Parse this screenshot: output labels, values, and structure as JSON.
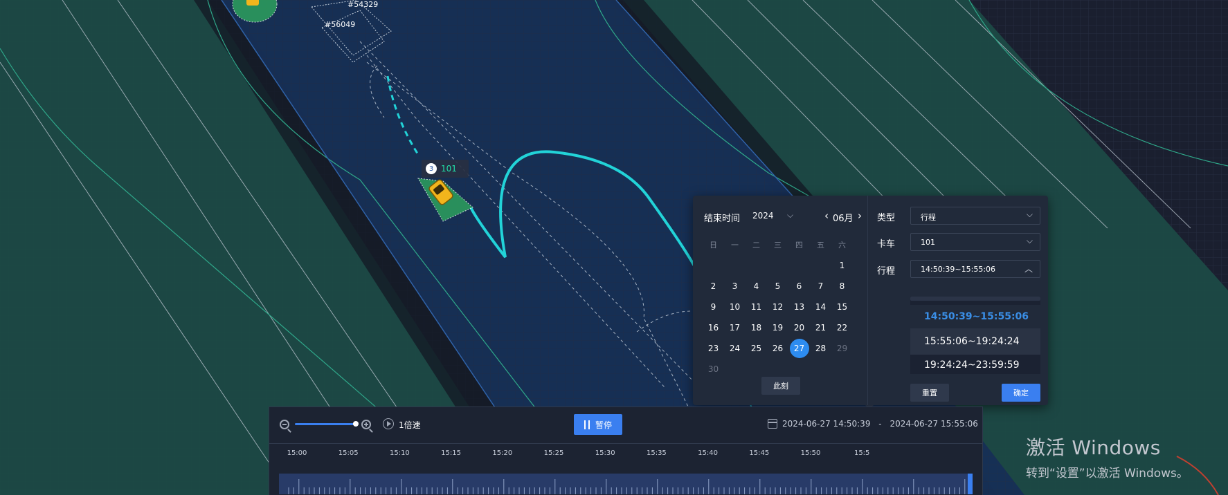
{
  "map": {
    "marker_labels": [
      {
        "text": "#54329"
      },
      {
        "text": "#56049"
      }
    ],
    "vehicle_tag": {
      "count": "3",
      "name": "101"
    }
  },
  "picker": {
    "calendar": {
      "title": "结束时间",
      "year": "2024",
      "month": "06月",
      "weekdays": [
        "日",
        "一",
        "二",
        "三",
        "四",
        "五",
        "六"
      ],
      "weeks": [
        [
          "",
          "",
          "",
          "",
          "",
          "",
          "1"
        ],
        [
          "2",
          "3",
          "4",
          "5",
          "6",
          "7",
          "8"
        ],
        [
          "9",
          "10",
          "11",
          "12",
          "13",
          "14",
          "15"
        ],
        [
          "16",
          "17",
          "18",
          "19",
          "20",
          "21",
          "22"
        ],
        [
          "23",
          "24",
          "25",
          "26",
          "27",
          "28",
          "29"
        ],
        [
          "30",
          "",
          "",
          "",
          "",
          "",
          ""
        ]
      ],
      "selected_day": "27",
      "disabled_days": [
        "29",
        "30"
      ],
      "now_label": "此刻"
    },
    "form": {
      "type_label": "类型",
      "type_value": "行程",
      "truck_label": "卡车",
      "truck_value": "101",
      "trip_label": "行程",
      "trip_value": "14:50:39~15:55:06",
      "options": [
        "14:50:39~15:55:06",
        "15:55:06~19:24:24",
        "19:24:24~23:59:59"
      ],
      "reset_label": "重置",
      "ok_label": "确定"
    }
  },
  "player": {
    "speed_label": "1倍速",
    "pause_label": "暂停",
    "range_start": "2024-06-27 14:50:39",
    "range_sep": "-",
    "range_end": "2024-06-27 15:55:06",
    "ticks": [
      "15:00",
      "15:05",
      "15:10",
      "15:15",
      "15:20",
      "15:25",
      "15:30",
      "15:35",
      "15:40",
      "15:45",
      "15:50",
      "15:5"
    ]
  },
  "watermark": {
    "line1": "激活 Windows",
    "line2": "转到“设置”以激活 Windows。"
  },
  "colors": {
    "background": "#1a1f2f",
    "road": "#173056",
    "shoulder": "#1c4a46",
    "trajectory": "#22d3d8",
    "accent": "#3a7ff0",
    "vehicle": "#f2b51c"
  },
  "icons": [
    "zoom-out-icon",
    "zoom-in-icon",
    "play-speed-icon",
    "pause-icon",
    "calendar-icon",
    "chevron-down-icon",
    "chevron-up-icon",
    "chevron-left-icon",
    "chevron-right-icon"
  ]
}
